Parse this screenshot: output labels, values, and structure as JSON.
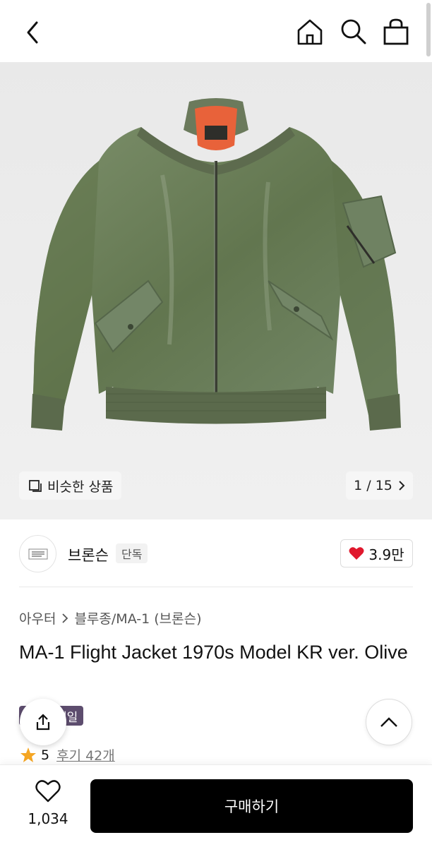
{
  "header": {
    "icons": [
      "back-icon",
      "home-icon",
      "search-icon",
      "bag-icon"
    ]
  },
  "gallery": {
    "similar_label": "비슷한 상품",
    "pager": "1 / 15"
  },
  "brand": {
    "name": "브론슨",
    "badge": "단독",
    "likes": "3.9만"
  },
  "product": {
    "breadcrumb": [
      "아우터",
      "블루종/MA-1 (브론슨)"
    ],
    "title": "MA-1 Flight Jacket 1970s Model KR ver. Olive",
    "sale_badge": "세일",
    "rating": "5",
    "reviews": "후기 42개"
  },
  "bottom": {
    "wish_count": "1,034",
    "buy_label": "구매하기"
  },
  "colors": {
    "jacket": "#6a7d5a",
    "lining": "#e8623a",
    "sale_badge": "#5d4d6e",
    "heart": "#e0182d",
    "star": "#f5a623"
  }
}
